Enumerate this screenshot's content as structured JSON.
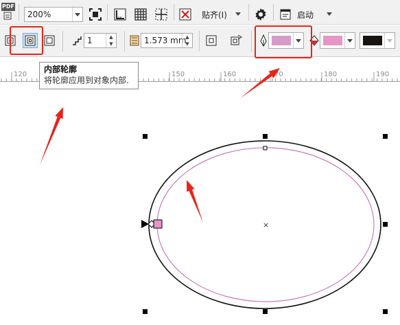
{
  "toolbar_top": {
    "pdf_label": "PDF",
    "zoom_value": "200%",
    "snap_label": "贴齐(I)",
    "launch_label": "启动"
  },
  "toolbar_contour": {
    "steps_value": "1",
    "offset_value": "1.573 mm",
    "outline_color": "#d79bc9",
    "fill_color": "#e596c4",
    "acceleration_color": "#1a1411"
  },
  "ruler": {
    "ticks": [
      "120",
      "150",
      "160",
      "70",
      "180",
      "190"
    ]
  },
  "tooltip": {
    "title": "内部轮廓",
    "description": "将轮廓应用到对象内部."
  },
  "canvas": {
    "object_outline_color": "#111111",
    "contour_color": "#c77bbb",
    "center_marker": "×"
  },
  "annotations": {
    "highlight_color": "#e8231a"
  }
}
